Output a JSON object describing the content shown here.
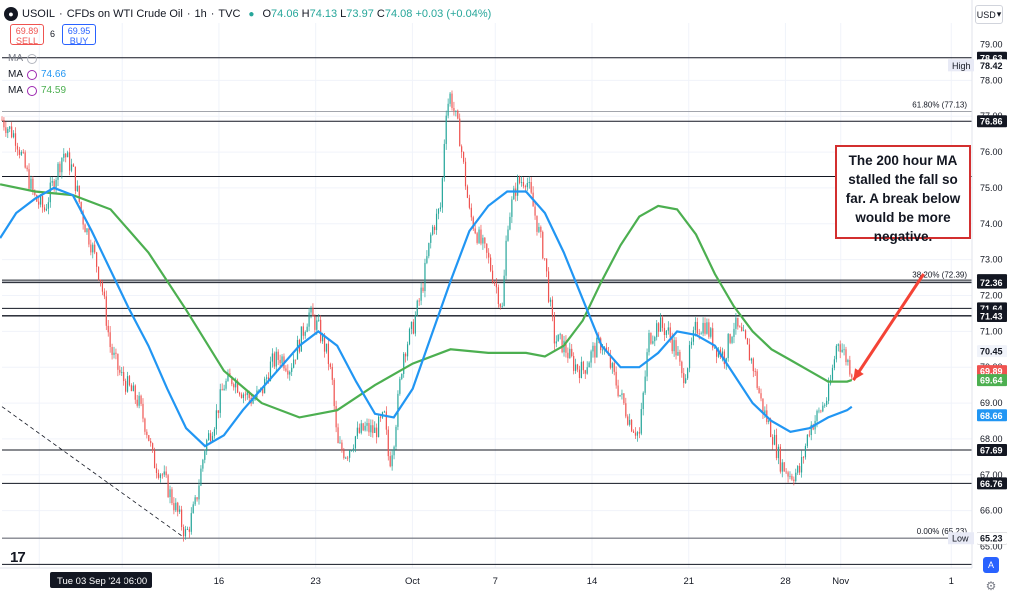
{
  "header": {
    "symbol": "USOIL",
    "title": "CFDs on WTI Crude Oil",
    "interval": "1h",
    "source": "TVC",
    "ohlc": [
      {
        "k": "O",
        "v": "74.06"
      },
      {
        "k": "H",
        "v": "74.13"
      },
      {
        "k": "L",
        "v": "73.97"
      },
      {
        "k": "C",
        "v": "74.08"
      },
      {
        "k": "",
        "v": "+0.03 (+0.04%)"
      }
    ]
  },
  "trade": {
    "sell_price": "69.89",
    "sell_label": "SELL",
    "spread": "6",
    "buy_price": "69.95",
    "buy_label": "BUY"
  },
  "indicators": [
    {
      "label": "MA",
      "value": ""
    },
    {
      "label": "MA",
      "value": "74.66",
      "color": "#2196f3"
    },
    {
      "label": "MA",
      "value": "74.59",
      "color": "#4caf50"
    }
  ],
  "currency": "USD",
  "auto_label": "A",
  "annotation": "The 200 hour MA stalled the fall so far. A break below would be more negative.",
  "colors": {
    "up": "#26a69a",
    "down": "#ef5350",
    "ma_fast": "#2196f3",
    "ma_slow": "#4caf50",
    "arrow": "#f44336",
    "callout_border": "#d32f2f"
  },
  "chart_data": {
    "type": "candlestick",
    "x_ticks": [
      {
        "day": 3,
        "label": "Tue 03 Sep '24  06:00",
        "highlight": true
      },
      {
        "day": 9,
        "label": "9"
      },
      {
        "day": 16,
        "label": "16"
      },
      {
        "day": 23,
        "label": "23"
      },
      {
        "day": 30,
        "label": "Oct"
      },
      {
        "day": 36,
        "label": "7"
      },
      {
        "day": 43,
        "label": "14"
      },
      {
        "day": 50,
        "label": "21"
      },
      {
        "day": 57,
        "label": "28"
      },
      {
        "day": 61,
        "label": "Nov"
      },
      {
        "day": 69,
        "label": "1"
      }
    ],
    "y_ticks": [
      78.0,
      77.0,
      76.0,
      75.0,
      74.0,
      73.0,
      72.0,
      71.0,
      70.0,
      69.0,
      68.0,
      67.0,
      66.0
    ],
    "y_tick_labels": [
      "78.00",
      "77.00",
      "76.00",
      "75.00",
      "74.00",
      "73.00",
      "72.00",
      "71.00",
      "70.00",
      "69.00",
      "68.00",
      "67.00",
      "66.00",
      "65.00"
    ],
    "top_partial_ticks": [
      "79.00"
    ],
    "ylim": [
      64.4,
      79.6
    ],
    "xlim": [
      0.3,
      70.5
    ],
    "levels": [
      {
        "value": 78.63,
        "label": "78.63"
      },
      {
        "value": 76.86,
        "label": "76.86"
      },
      {
        "value": 75.32,
        "label": ""
      },
      {
        "value": 72.43,
        "label": "72.43"
      },
      {
        "value": 72.36,
        "label": "72.36"
      },
      {
        "value": 71.64,
        "label": "71.64"
      },
      {
        "value": 71.44,
        "label": "71.44"
      },
      {
        "value": 71.43,
        "label": "71.43"
      },
      {
        "value": 67.69,
        "label": "67.69"
      },
      {
        "value": 66.76,
        "label": "66.76"
      },
      {
        "value": 65.23,
        "label": "65.23"
      },
      {
        "value": 64.5,
        "label": ""
      }
    ],
    "fib_levels": [
      {
        "value": 77.13,
        "label": "61.80% (77.13)"
      },
      {
        "value": 72.39,
        "label": "38.20% (72.39)"
      },
      {
        "value": 65.23,
        "label": "0.00% (65.23)"
      }
    ],
    "price_tags": [
      {
        "value": 78.42,
        "label": "78.42",
        "name": "High",
        "kind": "plain"
      },
      {
        "value": 70.45,
        "label": "70.45",
        "kind": "gray"
      },
      {
        "value": 69.89,
        "label": "69.89",
        "kind": "red"
      },
      {
        "value": 69.64,
        "label": "69.64",
        "kind": "green"
      },
      {
        "value": 68.66,
        "label": "68.66",
        "kind": "blue"
      },
      {
        "value": 65.23,
        "label": "65.23",
        "name": "Low",
        "kind": "plain"
      }
    ],
    "trend_line": {
      "from": [
        0.3,
        68.9
      ],
      "to": [
        13.3,
        65.3
      ]
    },
    "arrow": {
      "from": [
        67.0,
        72.6
      ],
      "to": [
        61.7,
        69.64
      ]
    },
    "anchors": [
      [
        0.5,
        76.9
      ],
      [
        2,
        76.4
      ],
      [
        3,
        75.5
      ],
      [
        4,
        74.7
      ],
      [
        5,
        74.4
      ],
      [
        6,
        75.2
      ],
      [
        7,
        76.0
      ],
      [
        8,
        75.5
      ],
      [
        9,
        74.2
      ],
      [
        10,
        73.4
      ],
      [
        11,
        72.4
      ],
      [
        12,
        70.5
      ],
      [
        13,
        69.8
      ],
      [
        14,
        69.4
      ],
      [
        15,
        69.0
      ],
      [
        16,
        68.1
      ],
      [
        16.5,
        67.4
      ],
      [
        17.5,
        67.0
      ],
      [
        19,
        66.0
      ],
      [
        20,
        65.3
      ],
      [
        21,
        66.2
      ],
      [
        22,
        67.8
      ],
      [
        23,
        68.5
      ],
      [
        24,
        69.5
      ],
      [
        25,
        69.7
      ],
      [
        26,
        69.3
      ],
      [
        27,
        69.1
      ],
      [
        28,
        69.3
      ],
      [
        29,
        70.1
      ],
      [
        30,
        70.3
      ],
      [
        31,
        70.0
      ],
      [
        32,
        70.7
      ],
      [
        33,
        71.5
      ],
      [
        34,
        71.1
      ],
      [
        35,
        70.3
      ],
      [
        35.5,
        69.5
      ],
      [
        36,
        67.8
      ],
      [
        37,
        67.6
      ],
      [
        38,
        68.1
      ],
      [
        39,
        68.3
      ],
      [
        40,
        68.2
      ],
      [
        41,
        68.6
      ],
      [
        41.5,
        67.3
      ],
      [
        42,
        68.0
      ],
      [
        43,
        70.4
      ],
      [
        44,
        71.1
      ],
      [
        45,
        72.2
      ],
      [
        46,
        73.8
      ],
      [
        47,
        74.5
      ],
      [
        47.5,
        77.2
      ],
      [
        48,
        77.6
      ],
      [
        49,
        76.4
      ],
      [
        50,
        74.3
      ],
      [
        51,
        73.6
      ],
      [
        52,
        73.0
      ],
      [
        53,
        72.1
      ],
      [
        53.5,
        71.6
      ],
      [
        54,
        74.0
      ],
      [
        55,
        75.1
      ],
      [
        56,
        75.3
      ],
      [
        57,
        74.2
      ],
      [
        58,
        73.0
      ],
      [
        58.5,
        71.8
      ],
      [
        59,
        70.8
      ],
      [
        60,
        70.6
      ],
      [
        61,
        70.1
      ],
      [
        62,
        69.9
      ],
      [
        63,
        70.4
      ],
      [
        64,
        70.7
      ],
      [
        65,
        70.0
      ],
      [
        66,
        69.2
      ],
      [
        67,
        68.5
      ],
      [
        68,
        68.1
      ],
      [
        69,
        70.8
      ],
      [
        70,
        71.2
      ],
      [
        71,
        71.0
      ],
      [
        72,
        70.4
      ],
      [
        72.5,
        69.7
      ],
      [
        73,
        70.0
      ],
      [
        74,
        71.1
      ],
      [
        75,
        71.2
      ],
      [
        76,
        70.6
      ],
      [
        77,
        70.3
      ],
      [
        78,
        71.2
      ],
      [
        79,
        70.8
      ],
      [
        80,
        70.1
      ],
      [
        81,
        68.9
      ],
      [
        82,
        68.2
      ],
      [
        83,
        67.3
      ],
      [
        84,
        67.0
      ],
      [
        85,
        67.1
      ],
      [
        86,
        68.3
      ],
      [
        87,
        68.7
      ],
      [
        88,
        69.2
      ],
      [
        89,
        70.8
      ],
      [
        90,
        70.2
      ],
      [
        90.5,
        69.9
      ]
    ],
    "ma_fast": [
      [
        0.3,
        73.6
      ],
      [
        2,
        74.3
      ],
      [
        4,
        74.7
      ],
      [
        6,
        75.0
      ],
      [
        8,
        74.8
      ],
      [
        10,
        73.8
      ],
      [
        12,
        72.7
      ],
      [
        14,
        71.6
      ],
      [
        16,
        70.6
      ],
      [
        18,
        69.4
      ],
      [
        20,
        68.3
      ],
      [
        22,
        67.8
      ],
      [
        24,
        68.1
      ],
      [
        26,
        68.8
      ],
      [
        28,
        69.4
      ],
      [
        30,
        70.0
      ],
      [
        32,
        70.6
      ],
      [
        34,
        71.0
      ],
      [
        36,
        70.6
      ],
      [
        38,
        69.6
      ],
      [
        40,
        68.7
      ],
      [
        42,
        68.6
      ],
      [
        44,
        69.4
      ],
      [
        46,
        70.9
      ],
      [
        48,
        72.4
      ],
      [
        50,
        73.8
      ],
      [
        52,
        74.5
      ],
      [
        54,
        74.9
      ],
      [
        56,
        74.9
      ],
      [
        58,
        74.3
      ],
      [
        60,
        73.2
      ],
      [
        62,
        71.9
      ],
      [
        64,
        70.6
      ],
      [
        66,
        70.0
      ],
      [
        68,
        70.0
      ],
      [
        70,
        70.4
      ],
      [
        72,
        71.0
      ],
      [
        74,
        70.9
      ],
      [
        76,
        70.6
      ],
      [
        78,
        69.8
      ],
      [
        80,
        69.0
      ],
      [
        82,
        68.5
      ],
      [
        84,
        68.2
      ],
      [
        86,
        68.3
      ],
      [
        88,
        68.6
      ],
      [
        90,
        68.8
      ],
      [
        90.5,
        68.9
      ]
    ],
    "ma_slow": [
      [
        0.3,
        75.1
      ],
      [
        4,
        74.9
      ],
      [
        8,
        74.8
      ],
      [
        12,
        74.4
      ],
      [
        16,
        73.2
      ],
      [
        20,
        71.6
      ],
      [
        24,
        69.9
      ],
      [
        28,
        69.0
      ],
      [
        32,
        68.6
      ],
      [
        36,
        68.8
      ],
      [
        40,
        69.5
      ],
      [
        44,
        70.1
      ],
      [
        48,
        70.5
      ],
      [
        52,
        70.4
      ],
      [
        56,
        70.4
      ],
      [
        58,
        70.3
      ],
      [
        60,
        70.6
      ],
      [
        62,
        71.3
      ],
      [
        64,
        72.4
      ],
      [
        66,
        73.4
      ],
      [
        68,
        74.2
      ],
      [
        70,
        74.5
      ],
      [
        72,
        74.4
      ],
      [
        74,
        73.7
      ],
      [
        76,
        72.6
      ],
      [
        78,
        71.7
      ],
      [
        80,
        71.0
      ],
      [
        82,
        70.5
      ],
      [
        84,
        70.2
      ],
      [
        86,
        69.9
      ],
      [
        88,
        69.6
      ],
      [
        90,
        69.6
      ],
      [
        90.5,
        69.64
      ]
    ]
  }
}
